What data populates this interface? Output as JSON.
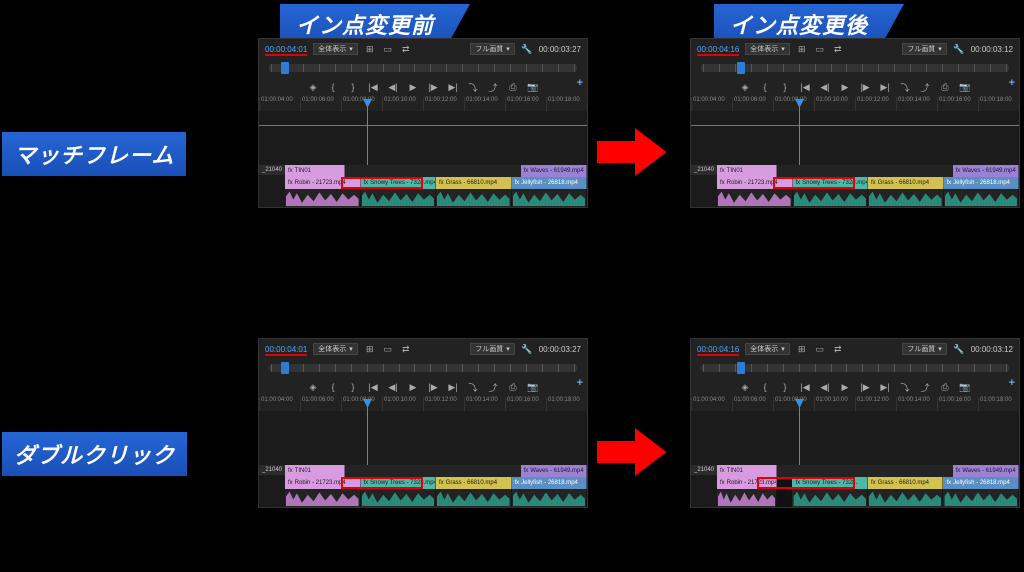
{
  "headers": {
    "before": "イン点変更前",
    "after": "イン点変更後"
  },
  "sidebars": {
    "match_frame": "マッチフレーム",
    "double_click": "ダブルクリック"
  },
  "toolbar": {
    "fit_label": "全体表示",
    "quality_label": "フル画質"
  },
  "panels": {
    "before": {
      "in_tc": "00:00:04:01",
      "dur_tc": "00:00:03:27"
    },
    "after": {
      "in_tc": "00:00:04:16",
      "dur_tc": "00:00:03:12"
    }
  },
  "time_ruler": [
    "01:00:04:00",
    "01:00:06:00",
    "01:00:08:00",
    "01:00:10:00",
    "01:00:12:00",
    "01:00:14:00",
    "01:00:16:00",
    "01:00:18:00"
  ],
  "tracks": {
    "v2_label": "_21040",
    "clips": {
      "tin": "TIN01",
      "robin": "Robin - 21723.mp4",
      "snowy": "Snowy Trees - 7328.mp4",
      "snowy_short": "Snowy Trees - 7328.",
      "grass": "Grass - 66810.mp4",
      "waves": "Waves - 61949.mp4",
      "jelly": "Jellyfish - 26818.mp4"
    }
  }
}
